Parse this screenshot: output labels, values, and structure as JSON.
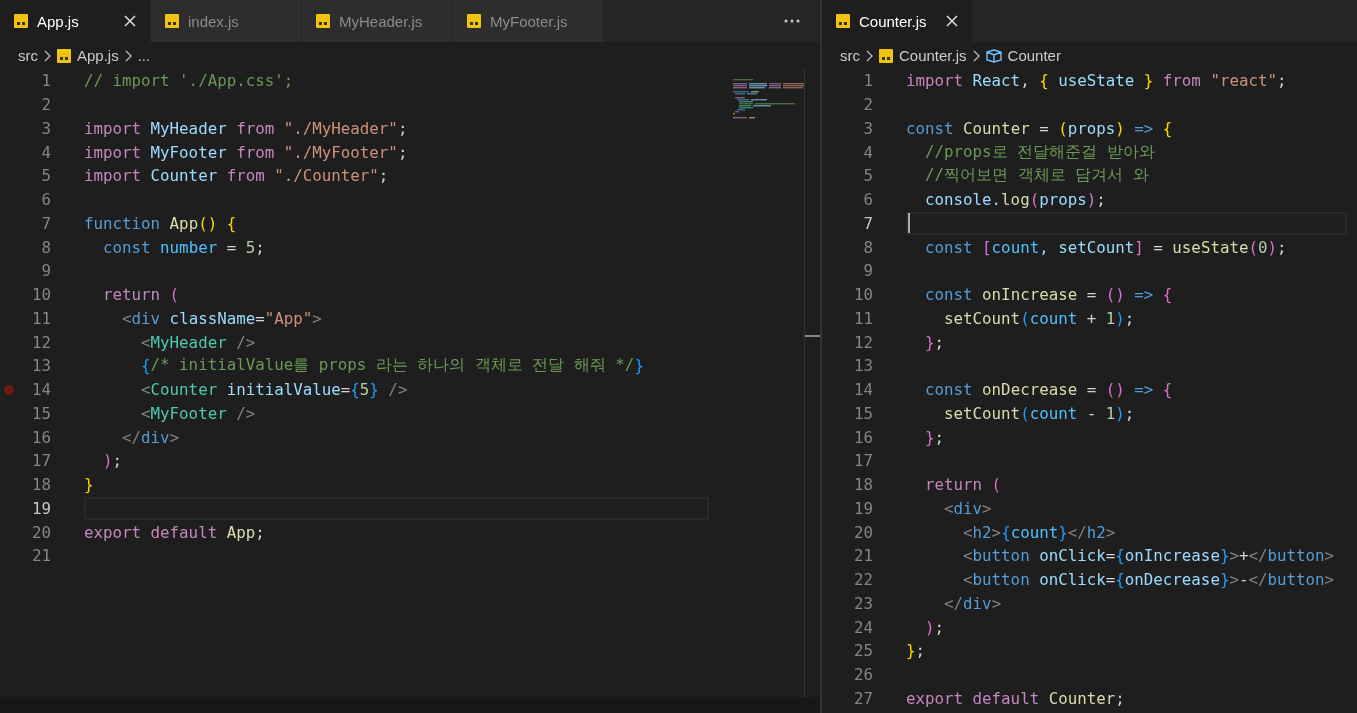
{
  "editor_groups": [
    {
      "tabs": [
        {
          "label": "App.js",
          "selected": true
        },
        {
          "label": "index.js",
          "selected": false
        },
        {
          "label": "MyHeader.js",
          "selected": false
        },
        {
          "label": "MyFooter.js",
          "selected": false
        }
      ],
      "more_actions": true,
      "breadcrumbs": [
        {
          "label": "src",
          "kind": "folder"
        },
        {
          "label": "App.js",
          "kind": "file"
        },
        {
          "label": "...",
          "kind": "more"
        }
      ],
      "minimap": true,
      "lines": [
        {
          "n": "1",
          "kind": "normal",
          "tokens": [
            {
              "text": "// import './App.css';",
              "color": "#6a9955"
            }
          ]
        },
        {
          "n": "2",
          "kind": "normal"
        },
        {
          "n": "3",
          "kind": "normal",
          "tokens": [
            {
              "text": "import ",
              "color": "#c586c0"
            },
            {
              "text": "MyHeader ",
              "color": "#9cdcfe"
            },
            {
              "text": "from ",
              "color": "#c586c0"
            },
            {
              "text": "\"./MyHeader\"",
              "color": "#ce9178"
            },
            {
              "text": ";",
              "color": "#d4d4d4"
            }
          ]
        },
        {
          "n": "4",
          "kind": "normal",
          "tokens": [
            {
              "text": "import ",
              "color": "#c586c0"
            },
            {
              "text": "MyFooter ",
              "color": "#9cdcfe"
            },
            {
              "text": "from ",
              "color": "#c586c0"
            },
            {
              "text": "\"./MyFooter\"",
              "color": "#ce9178"
            },
            {
              "text": ";",
              "color": "#d4d4d4"
            }
          ]
        },
        {
          "n": "5",
          "kind": "normal",
          "tokens": [
            {
              "text": "import ",
              "color": "#c586c0"
            },
            {
              "text": "Counter ",
              "color": "#9cdcfe"
            },
            {
              "text": "from ",
              "color": "#c586c0"
            },
            {
              "text": "\"./Counter\"",
              "color": "#ce9178"
            },
            {
              "text": ";",
              "color": "#d4d4d4"
            }
          ]
        },
        {
          "n": "6",
          "kind": "normal"
        },
        {
          "n": "7",
          "kind": "normal",
          "tokens": [
            {
              "text": "function ",
              "color": "#569cd6"
            },
            {
              "text": "App",
              "color": "#dcdcaa"
            },
            {
              "text": "() {",
              "color": "#ffd700"
            }
          ]
        },
        {
          "n": "8",
          "kind": "normal",
          "tokens": [
            {
              "text": "  const ",
              "color": "#569cd6"
            },
            {
              "text": "number",
              "color": "#4fc1ff"
            },
            {
              "text": " = ",
              "color": "#d4d4d4"
            },
            {
              "text": "5",
              "color": "#b5cea8"
            },
            {
              "text": ";",
              "color": "#d4d4d4"
            }
          ]
        },
        {
          "n": "9",
          "kind": "normal"
        },
        {
          "n": "10",
          "kind": "normal",
          "tokens": [
            {
              "text": "  return ",
              "color": "#c586c0"
            },
            {
              "text": "(",
              "color": "#da70d6"
            }
          ]
        },
        {
          "n": "11",
          "kind": "normal",
          "tokens": [
            {
              "text": "    <",
              "color": "#808080"
            },
            {
              "text": "div",
              "color": "#569cd6"
            },
            {
              "text": " className",
              "color": "#9cdcfe"
            },
            {
              "text": "=",
              "color": "#d4d4d4"
            },
            {
              "text": "\"App\"",
              "color": "#ce9178"
            },
            {
              "text": ">",
              "color": "#808080"
            }
          ]
        },
        {
          "n": "12",
          "kind": "normal",
          "tokens": [
            {
              "text": "      <",
              "color": "#808080"
            },
            {
              "text": "MyHeader",
              "color": "#4ec9b0"
            },
            {
              "text": " />",
              "color": "#808080"
            }
          ]
        },
        {
          "n": "13",
          "kind": "normal",
          "tokens": [
            {
              "text": "      {",
              "color": "#179fff"
            },
            {
              "text": "/* initialValue를 props 라는 하나의 객체로 전달 해줘 */",
              "color": "#6a9955"
            },
            {
              "text": "}",
              "color": "#179fff"
            }
          ]
        },
        {
          "n": "14",
          "kind": "breakpoint",
          "tokens": [
            {
              "text": "      <",
              "color": "#808080"
            },
            {
              "text": "Counter",
              "color": "#4ec9b0"
            },
            {
              "text": " initialValue",
              "color": "#9cdcfe"
            },
            {
              "text": "=",
              "color": "#d4d4d4"
            },
            {
              "text": "{",
              "color": "#179fff"
            },
            {
              "text": "5",
              "color": "#b5cea8"
            },
            {
              "text": "}",
              "color": "#179fff"
            },
            {
              "text": " />",
              "color": "#808080"
            }
          ]
        },
        {
          "n": "15",
          "kind": "normal",
          "tokens": [
            {
              "text": "      <",
              "color": "#808080"
            },
            {
              "text": "MyFooter",
              "color": "#4ec9b0"
            },
            {
              "text": " />",
              "color": "#808080"
            }
          ]
        },
        {
          "n": "16",
          "kind": "normal",
          "tokens": [
            {
              "text": "    </",
              "color": "#808080"
            },
            {
              "text": "div",
              "color": "#569cd6"
            },
            {
              "text": ">",
              "color": "#808080"
            }
          ]
        },
        {
          "n": "17",
          "kind": "normal",
          "tokens": [
            {
              "text": "  )",
              "color": "#da70d6"
            },
            {
              "text": ";",
              "color": "#d4d4d4"
            }
          ]
        },
        {
          "n": "18",
          "kind": "normal",
          "tokens": [
            {
              "text": "}",
              "color": "#ffd700"
            }
          ]
        },
        {
          "n": "19",
          "kind": "current"
        },
        {
          "n": "20",
          "kind": "normal",
          "tokens": [
            {
              "text": "export default ",
              "color": "#c586c0"
            },
            {
              "text": "App",
              "color": "#dcdcaa"
            },
            {
              "text": ";",
              "color": "#d4d4d4"
            }
          ]
        },
        {
          "n": "21",
          "kind": "normal"
        }
      ]
    },
    {
      "tabs": [
        {
          "label": "Counter.js",
          "selected": true
        }
      ],
      "more_actions": false,
      "breadcrumbs": [
        {
          "label": "src",
          "kind": "folder"
        },
        {
          "label": "Counter.js",
          "kind": "file"
        },
        {
          "label": "Counter",
          "kind": "symbol"
        }
      ],
      "minimap": false,
      "lines": [
        {
          "n": "1",
          "kind": "normal",
          "tokens": [
            {
              "text": "import ",
              "color": "#c586c0"
            },
            {
              "text": "React",
              "color": "#9cdcfe"
            },
            {
              "text": ", ",
              "color": "#d4d4d4"
            },
            {
              "text": "{",
              "color": "#ffd700"
            },
            {
              "text": " useState ",
              "color": "#9cdcfe"
            },
            {
              "text": "}",
              "color": "#ffd700"
            },
            {
              "text": " from ",
              "color": "#c586c0"
            },
            {
              "text": "\"react\"",
              "color": "#ce9178"
            },
            {
              "text": ";",
              "color": "#d4d4d4"
            }
          ]
        },
        {
          "n": "2",
          "kind": "normal"
        },
        {
          "n": "3",
          "kind": "normal",
          "tokens": [
            {
              "text": "const ",
              "color": "#569cd6"
            },
            {
              "text": "Counter",
              "color": "#dcdcaa"
            },
            {
              "text": " = ",
              "color": "#d4d4d4"
            },
            {
              "text": "(",
              "color": "#ffd700"
            },
            {
              "text": "props",
              "color": "#9cdcfe"
            },
            {
              "text": ")",
              "color": "#ffd700"
            },
            {
              "text": " => ",
              "color": "#569cd6"
            },
            {
              "text": "{",
              "color": "#ffd700"
            }
          ]
        },
        {
          "n": "4",
          "kind": "normal",
          "tokens": [
            {
              "text": "  //props로 전달해준걸 받아와",
              "color": "#6a9955"
            }
          ]
        },
        {
          "n": "5",
          "kind": "normal",
          "tokens": [
            {
              "text": "  //찍어보면 객체로 담겨서 와",
              "color": "#6a9955"
            }
          ]
        },
        {
          "n": "6",
          "kind": "normal",
          "tokens": [
            {
              "text": "  console.",
              "color": "#9cdcfe"
            },
            {
              "text": "log",
              "color": "#dcdcaa"
            },
            {
              "text": "(",
              "color": "#da70d6"
            },
            {
              "text": "props",
              "color": "#9cdcfe"
            },
            {
              "text": ")",
              "color": "#da70d6"
            },
            {
              "text": ";",
              "color": "#d4d4d4"
            }
          ]
        },
        {
          "n": "7",
          "kind": "current"
        },
        {
          "n": "8",
          "kind": "normal",
          "tokens": [
            {
              "text": "  const ",
              "color": "#569cd6"
            },
            {
              "text": "[",
              "color": "#da70d6"
            },
            {
              "text": "count",
              "color": "#4fc1ff"
            },
            {
              "text": ", setCount",
              "color": "#9cdcfe"
            },
            {
              "text": "]",
              "color": "#da70d6"
            },
            {
              "text": " = ",
              "color": "#d4d4d4"
            },
            {
              "text": "useState",
              "color": "#dcdcaa"
            },
            {
              "text": "(",
              "color": "#da70d6"
            },
            {
              "text": "0",
              "color": "#b5cea8"
            },
            {
              "text": ")",
              "color": "#da70d6"
            },
            {
              "text": ";",
              "color": "#d4d4d4"
            }
          ]
        },
        {
          "n": "9",
          "kind": "normal"
        },
        {
          "n": "10",
          "kind": "normal",
          "tokens": [
            {
              "text": "  const ",
              "color": "#569cd6"
            },
            {
              "text": "onIncrease",
              "color": "#dcdcaa"
            },
            {
              "text": " = ",
              "color": "#d4d4d4"
            },
            {
              "text": "()",
              "color": "#da70d6"
            },
            {
              "text": " => ",
              "color": "#569cd6"
            },
            {
              "text": "{",
              "color": "#da70d6"
            }
          ]
        },
        {
          "n": "11",
          "kind": "normal",
          "tokens": [
            {
              "text": "    setCount",
              "color": "#dcdcaa"
            },
            {
              "text": "(",
              "color": "#179fff"
            },
            {
              "text": "count",
              "color": "#4fc1ff"
            },
            {
              "text": " + ",
              "color": "#d4d4d4"
            },
            {
              "text": "1",
              "color": "#b5cea8"
            },
            {
              "text": ")",
              "color": "#179fff"
            },
            {
              "text": ";",
              "color": "#d4d4d4"
            }
          ]
        },
        {
          "n": "12",
          "kind": "normal",
          "tokens": [
            {
              "text": "  }",
              "color": "#da70d6"
            },
            {
              "text": ";",
              "color": "#d4d4d4"
            }
          ]
        },
        {
          "n": "13",
          "kind": "normal"
        },
        {
          "n": "14",
          "kind": "normal",
          "tokens": [
            {
              "text": "  const ",
              "color": "#569cd6"
            },
            {
              "text": "onDecrease",
              "color": "#dcdcaa"
            },
            {
              "text": " = ",
              "color": "#d4d4d4"
            },
            {
              "text": "()",
              "color": "#da70d6"
            },
            {
              "text": " => ",
              "color": "#569cd6"
            },
            {
              "text": "{",
              "color": "#da70d6"
            }
          ]
        },
        {
          "n": "15",
          "kind": "normal",
          "tokens": [
            {
              "text": "    setCount",
              "color": "#dcdcaa"
            },
            {
              "text": "(",
              "color": "#179fff"
            },
            {
              "text": "count",
              "color": "#4fc1ff"
            },
            {
              "text": " - ",
              "color": "#d4d4d4"
            },
            {
              "text": "1",
              "color": "#b5cea8"
            },
            {
              "text": ")",
              "color": "#179fff"
            },
            {
              "text": ";",
              "color": "#d4d4d4"
            }
          ]
        },
        {
          "n": "16",
          "kind": "normal",
          "tokens": [
            {
              "text": "  }",
              "color": "#da70d6"
            },
            {
              "text": ";",
              "color": "#d4d4d4"
            }
          ]
        },
        {
          "n": "17",
          "kind": "normal"
        },
        {
          "n": "18",
          "kind": "normal",
          "tokens": [
            {
              "text": "  return ",
              "color": "#c586c0"
            },
            {
              "text": "(",
              "color": "#da70d6"
            }
          ]
        },
        {
          "n": "19",
          "kind": "normal",
          "tokens": [
            {
              "text": "    <",
              "color": "#808080"
            },
            {
              "text": "div",
              "color": "#569cd6"
            },
            {
              "text": ">",
              "color": "#808080"
            }
          ]
        },
        {
          "n": "20",
          "kind": "normal",
          "tokens": [
            {
              "text": "      <",
              "color": "#808080"
            },
            {
              "text": "h2",
              "color": "#569cd6"
            },
            {
              "text": ">",
              "color": "#808080"
            },
            {
              "text": "{",
              "color": "#179fff"
            },
            {
              "text": "count",
              "color": "#4fc1ff"
            },
            {
              "text": "}",
              "color": "#179fff"
            },
            {
              "text": "</",
              "color": "#808080"
            },
            {
              "text": "h2",
              "color": "#569cd6"
            },
            {
              "text": ">",
              "color": "#808080"
            }
          ]
        },
        {
          "n": "21",
          "kind": "normal",
          "tokens": [
            {
              "text": "      <",
              "color": "#808080"
            },
            {
              "text": "button",
              "color": "#569cd6"
            },
            {
              "text": " onClick",
              "color": "#9cdcfe"
            },
            {
              "text": "=",
              "color": "#d4d4d4"
            },
            {
              "text": "{",
              "color": "#179fff"
            },
            {
              "text": "onIncrease",
              "color": "#9cdcfe"
            },
            {
              "text": "}",
              "color": "#179fff"
            },
            {
              "text": ">",
              "color": "#808080"
            },
            {
              "text": "+",
              "color": "#d4d4d4"
            },
            {
              "text": "</",
              "color": "#808080"
            },
            {
              "text": "button",
              "color": "#569cd6"
            },
            {
              "text": ">",
              "color": "#808080"
            }
          ]
        },
        {
          "n": "22",
          "kind": "normal",
          "tokens": [
            {
              "text": "      <",
              "color": "#808080"
            },
            {
              "text": "button",
              "color": "#569cd6"
            },
            {
              "text": " onClick",
              "color": "#9cdcfe"
            },
            {
              "text": "=",
              "color": "#d4d4d4"
            },
            {
              "text": "{",
              "color": "#179fff"
            },
            {
              "text": "onDecrease",
              "color": "#9cdcfe"
            },
            {
              "text": "}",
              "color": "#179fff"
            },
            {
              "text": ">",
              "color": "#808080"
            },
            {
              "text": "-",
              "color": "#d4d4d4"
            },
            {
              "text": "</",
              "color": "#808080"
            },
            {
              "text": "button",
              "color": "#569cd6"
            },
            {
              "text": ">",
              "color": "#808080"
            }
          ]
        },
        {
          "n": "23",
          "kind": "normal",
          "tokens": [
            {
              "text": "    </",
              "color": "#808080"
            },
            {
              "text": "div",
              "color": "#569cd6"
            },
            {
              "text": ">",
              "color": "#808080"
            }
          ]
        },
        {
          "n": "24",
          "kind": "normal",
          "tokens": [
            {
              "text": "  )",
              "color": "#da70d6"
            },
            {
              "text": ";",
              "color": "#d4d4d4"
            }
          ]
        },
        {
          "n": "25",
          "kind": "normal",
          "tokens": [
            {
              "text": "}",
              "color": "#ffd700"
            },
            {
              "text": ";",
              "color": "#d4d4d4"
            }
          ]
        },
        {
          "n": "26",
          "kind": "normal"
        },
        {
          "n": "27",
          "kind": "normal",
          "tokens": [
            {
              "text": "export default ",
              "color": "#c586c0"
            },
            {
              "text": "Counter",
              "color": "#dcdcaa"
            },
            {
              "text": ";",
              "color": "#d4d4d4"
            }
          ]
        }
      ]
    }
  ]
}
